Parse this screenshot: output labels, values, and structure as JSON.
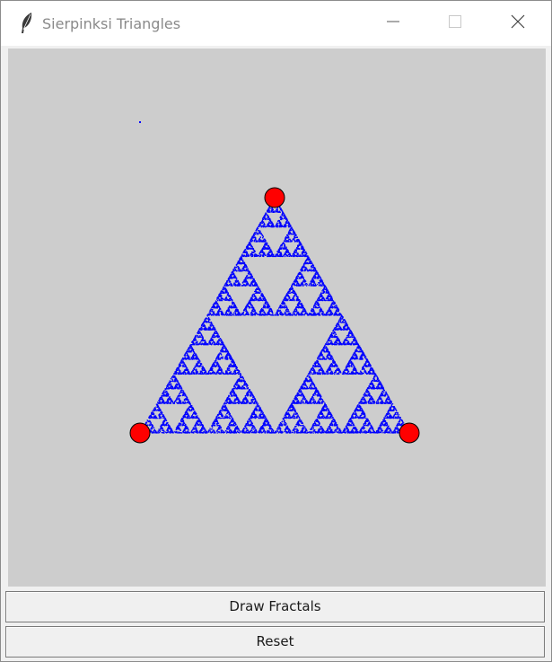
{
  "window": {
    "title": "Sierpinksi Triangles",
    "icon": "feather-icon",
    "controls": [
      "minimize-icon",
      "maximize-icon",
      "close-icon"
    ]
  },
  "canvas": {
    "background": "#cdcdcd",
    "point_color": "#0000ff",
    "vertex_color": "#ff0000"
  },
  "buttons": {
    "draw_label": "Draw Fractals",
    "reset_label": "Reset"
  }
}
